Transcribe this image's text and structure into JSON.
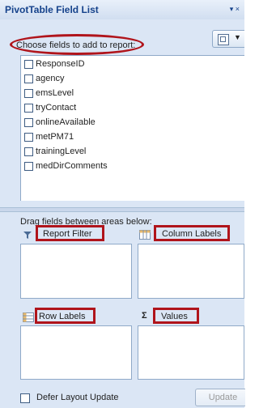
{
  "header": {
    "title": "PivotTable Field List",
    "controls": "▾ ×"
  },
  "chooser": {
    "label": "Choose fields to add to report:"
  },
  "fields": [
    {
      "label": "ResponseID",
      "checked": false
    },
    {
      "label": "agency",
      "checked": false
    },
    {
      "label": "emsLevel",
      "checked": false
    },
    {
      "label": "tryContact",
      "checked": false
    },
    {
      "label": "onlineAvailable",
      "checked": false
    },
    {
      "label": "metPM71",
      "checked": false
    },
    {
      "label": "trainingLevel",
      "checked": false
    },
    {
      "label": "medDirComments",
      "checked": false
    }
  ],
  "areas": {
    "drag_label": "Drag fields between areas below:",
    "report_filter": "Report Filter",
    "column_labels": "Column Labels",
    "row_labels": "Row Labels",
    "values": "Values",
    "sigma": "Σ"
  },
  "footer": {
    "defer_label": "Defer Layout Update",
    "update_label": "Update"
  },
  "icons": {
    "filter": "filter-icon",
    "column": "column-labels-icon",
    "row": "row-labels-icon",
    "values": "sigma-icon",
    "layout": "layout-icon"
  },
  "colors": {
    "highlight": "#b0141b",
    "title": "#15428b",
    "pane": "#dbe6f5"
  }
}
